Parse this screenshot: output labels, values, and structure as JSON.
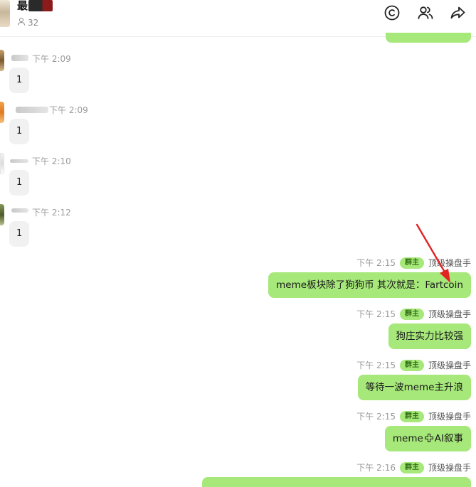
{
  "header": {
    "title": "最",
    "member_count": "32",
    "icons": {
      "refresh": "copyright-icon",
      "members": "members-icon",
      "share": "share-icon"
    }
  },
  "left_messages": [
    {
      "time": "下午 2:09",
      "text": "1"
    },
    {
      "time": "下午 2:09",
      "text": "1"
    },
    {
      "time": "下午 2:10",
      "text": "1"
    },
    {
      "time": "下午 2:12",
      "text": "1"
    }
  ],
  "right_messages": [
    {
      "time": "下午 2:15",
      "badge": "群主",
      "sender": "顶级操盘手",
      "text": "meme板块除了狗狗币 其次就是：Fartcoin"
    },
    {
      "time": "下午 2:15",
      "badge": "群主",
      "sender": "顶级操盘手",
      "text": "狗庄实力比较强"
    },
    {
      "time": "下午 2:15",
      "badge": "群主",
      "sender": "顶级操盘手",
      "text": "等待一波meme主升浪"
    },
    {
      "time": "下午 2:15",
      "badge": "群主",
      "sender": "顶级操盘手",
      "text_before": "meme",
      "text_after": "AI叙事"
    },
    {
      "time": "下午 2:16",
      "badge": "群主",
      "sender": "顶级操盘手"
    }
  ],
  "colors": {
    "bubble_self": "#a6e879",
    "bubble_other": "#f1f1f1",
    "arrow": "#e02424"
  }
}
